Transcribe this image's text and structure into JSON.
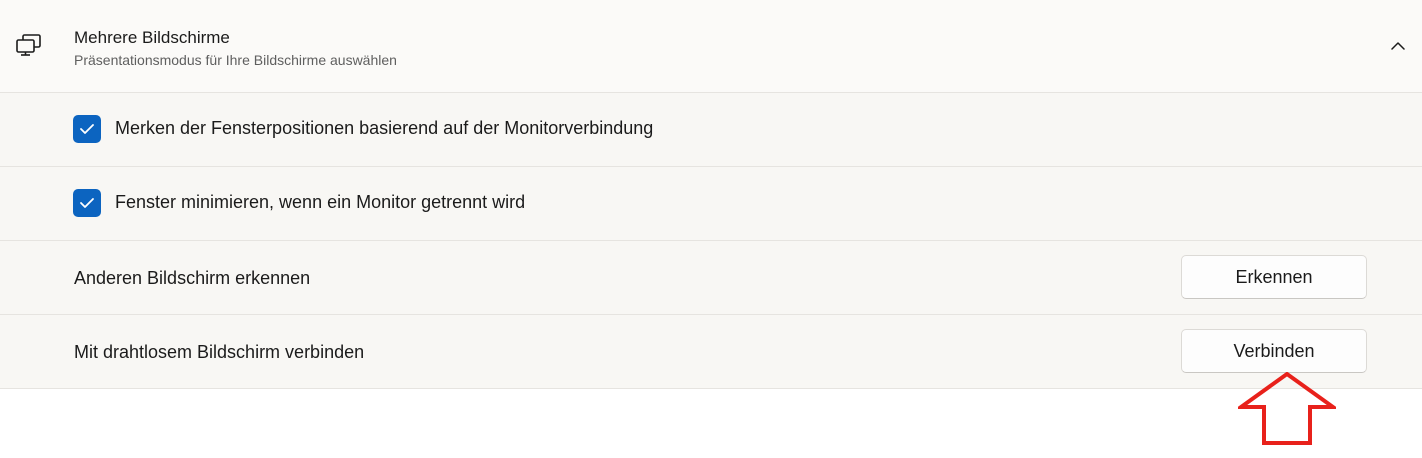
{
  "header": {
    "title": "Mehrere Bildschirme",
    "subtitle": "Präsentationsmodus für Ihre Bildschirme auswählen",
    "icon": "multi-monitor-icon",
    "expand_icon": "chevron-up-icon"
  },
  "options": [
    {
      "label": "Merken der Fensterpositionen basierend auf der Monitorverbindung",
      "checked": true
    },
    {
      "label": "Fenster minimieren, wenn ein Monitor getrennt wird",
      "checked": true
    }
  ],
  "actions": [
    {
      "label": "Anderen Bildschirm erkennen",
      "button": "Erkennen"
    },
    {
      "label": "Mit drahtlosem Bildschirm verbinden",
      "button": "Verbinden"
    }
  ],
  "annotation": {
    "icon": "up-arrow-annotation",
    "color": "#e8211b"
  },
  "colors": {
    "accent": "#0c64c0",
    "row_background": "#f8f7f4"
  }
}
